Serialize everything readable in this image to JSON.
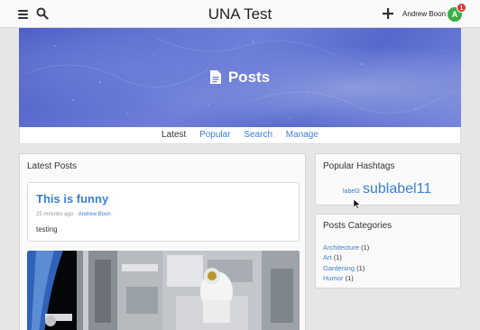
{
  "header": {
    "title": "UNA Test",
    "user_name": "Andrew Boon",
    "avatar_letter": "A",
    "notification_count": "1"
  },
  "hero": {
    "title": "Posts"
  },
  "subnav": {
    "items": [
      "Latest",
      "Popular",
      "Search",
      "Manage"
    ]
  },
  "latest_posts": {
    "title": "Latest Posts",
    "post": {
      "title": "This is funny",
      "time": "25 minutes ago",
      "author": "Andrew Boon",
      "text": "testing"
    }
  },
  "hashtags": {
    "title": "Popular Hashtags",
    "tags": [
      "label3",
      "sublabel11"
    ]
  },
  "categories": {
    "title": "Posts Categories",
    "items": [
      {
        "name": "Architecture",
        "count": "(1)"
      },
      {
        "name": "Art",
        "count": "(1)"
      },
      {
        "name": "Gardening",
        "count": "(1)"
      },
      {
        "name": "Humor",
        "count": "(1)"
      }
    ]
  },
  "colors": {
    "accent": "#3a7fd5",
    "avatar": "#3cad46",
    "badge": "#d9342b"
  }
}
